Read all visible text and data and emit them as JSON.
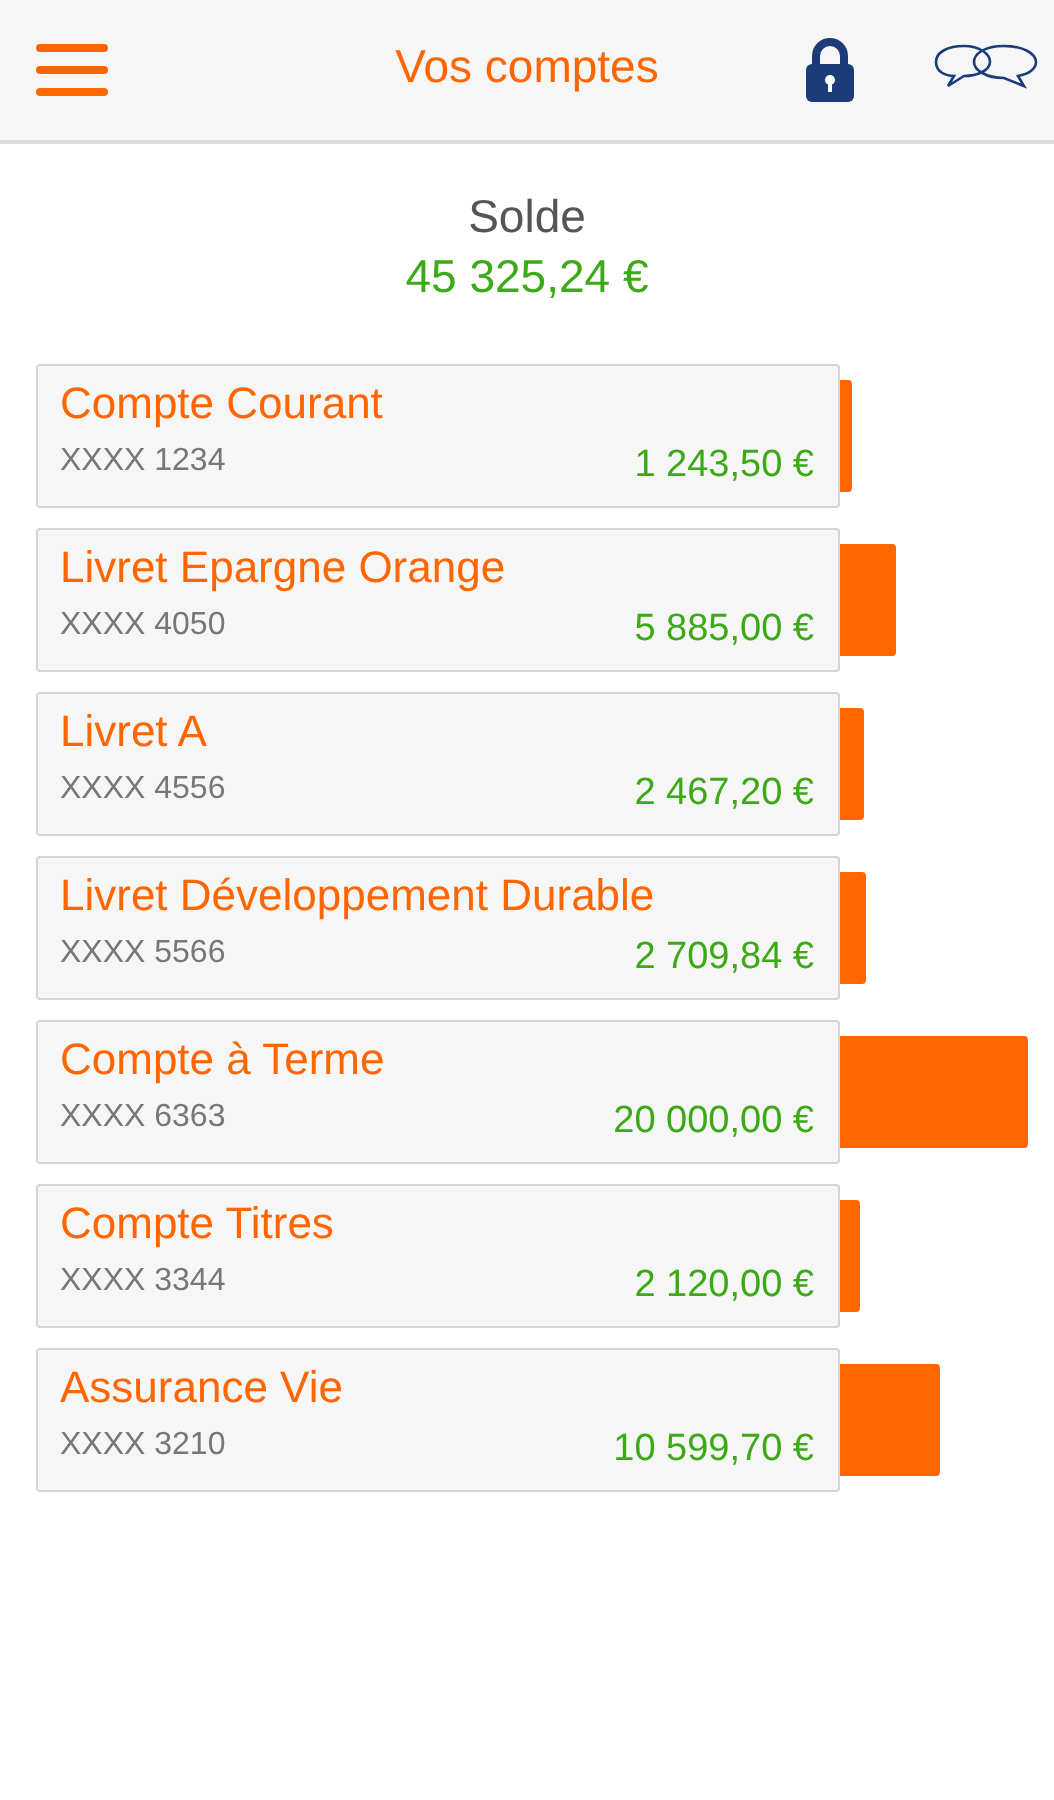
{
  "header": {
    "title": "Vos comptes"
  },
  "balance": {
    "label": "Solde",
    "amount": "45 325,24 €"
  },
  "accounts": [
    {
      "name": "Compte Courant",
      "number": "XXXX 1234",
      "amount": "1 243,50 €"
    },
    {
      "name": "Livret Epargne Orange",
      "number": "XXXX 4050",
      "amount": "5 885,00 €"
    },
    {
      "name": "Livret A",
      "number": "XXXX 4556",
      "amount": "2 467,20 €"
    },
    {
      "name": "Livret Développement Durable",
      "number": "XXXX 5566",
      "amount": "2 709,84 €"
    },
    {
      "name": "Compte à Terme",
      "number": "XXXX 6363",
      "amount": "20 000,00 €"
    },
    {
      "name": "Compte Titres",
      "number": "XXXX 3344",
      "amount": "2 120,00 €"
    },
    {
      "name": "Assurance Vie",
      "number": "XXXX 3210",
      "amount": "10 599,70 €"
    }
  ]
}
